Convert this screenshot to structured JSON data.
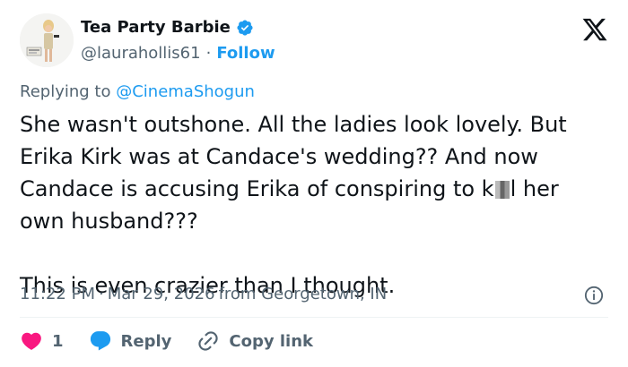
{
  "author": {
    "display_name": "Tea Party Barbie",
    "handle": "@laurahollis61",
    "separator": "·",
    "follow_label": "Follow",
    "verified": true
  },
  "reply_context": {
    "prefix": "Replying to",
    "mention": "@CinemaShogun"
  },
  "tweet": {
    "line1": "She wasn't outshone. All the ladies look lovely. But",
    "line2": "Erika Kirk was at Candace's wedding?? And now",
    "line3_before": "Candace is accusing Erika of conspiring to k",
    "line3_after": "l her",
    "line4": "own husband???",
    "line5": "This is even crazier than I thought."
  },
  "meta": {
    "time": "11:22 PM",
    "separator": "·",
    "date": "Mar 29, 2026",
    "location": "from Georgetown, IN"
  },
  "actions": {
    "like_count": "1",
    "reply_label": "Reply",
    "copy_label": "Copy link"
  },
  "colors": {
    "accent": "#1d9bf0",
    "like": "#f91880",
    "muted": "#536471",
    "text": "#0f1419"
  },
  "icons": {
    "verified": "verified-badge-icon",
    "logo": "x-logo-icon",
    "info": "info-icon",
    "like": "heart-icon",
    "reply": "reply-bubble-icon",
    "copy": "link-icon"
  }
}
